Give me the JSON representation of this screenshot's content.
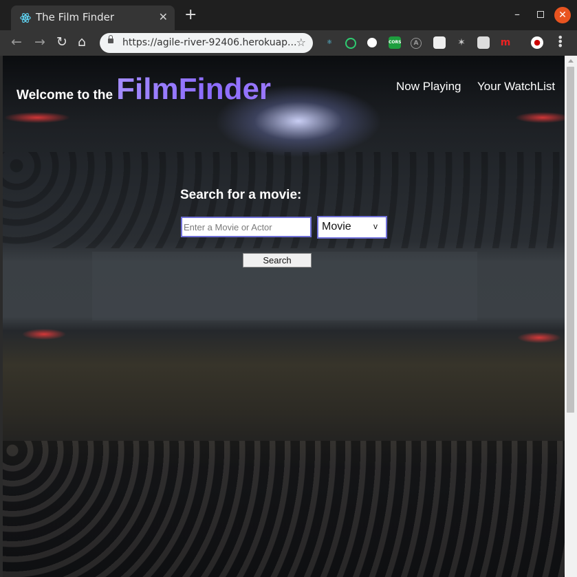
{
  "browser": {
    "tab_title": "The Film Finder",
    "tab_close": "✕",
    "new_tab": "+",
    "url": "https://agile-river-92406.herokuap...",
    "window_buttons": {
      "minimize": "–",
      "close": "✕"
    }
  },
  "header": {
    "welcome": "Welcome to the",
    "brand": "FilmFinder",
    "nav": {
      "now_playing": "Now Playing",
      "watchlist": "Your WatchList"
    }
  },
  "search": {
    "title": "Search for a movie:",
    "placeholder": "Enter a Movie or Actor",
    "type_selected": "Movie",
    "type_arrow": "v",
    "button": "Search"
  },
  "extensions": {
    "cors_label": "CORS"
  },
  "colors": {
    "brand": "#9a7cff",
    "input_border": "#7070d8",
    "close_button": "#e95420"
  }
}
